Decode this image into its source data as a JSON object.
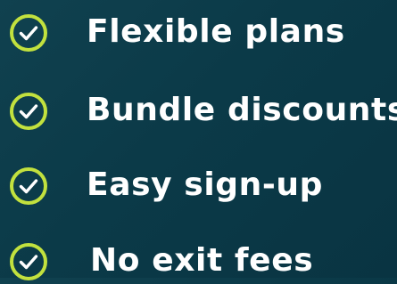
{
  "colors": {
    "background": "#0b3a48",
    "accent": "#c2e13e",
    "text": "#ffffff"
  },
  "features": [
    {
      "label": "Flexible plans",
      "icon": "check-circle-icon"
    },
    {
      "label": "Bundle discounts",
      "icon": "check-circle-icon"
    },
    {
      "label": "Easy sign-up",
      "icon": "check-circle-icon"
    },
    {
      "label": "No exit fees",
      "icon": "check-circle-icon"
    }
  ]
}
